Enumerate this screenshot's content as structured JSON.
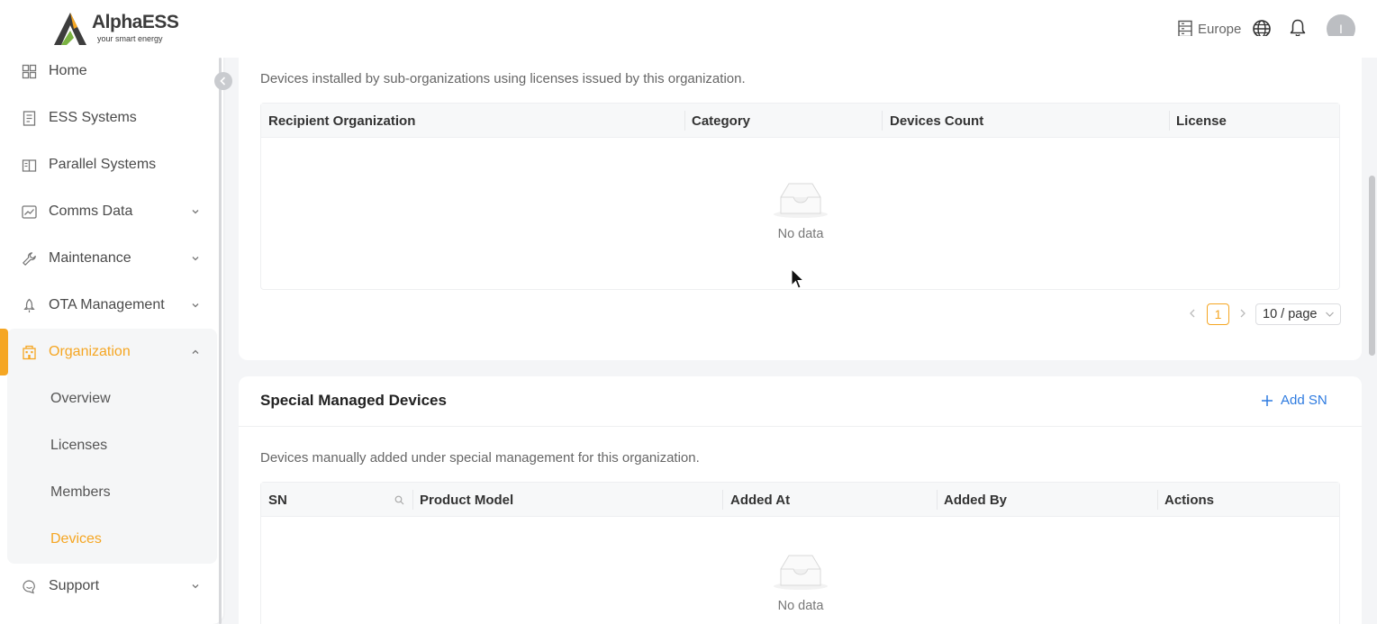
{
  "brand": {
    "name": "AlphaESS",
    "tagline": "your smart energy",
    "accent": "#f5a623"
  },
  "sidebar": {
    "items": [
      {
        "label": "Home",
        "icon": "home-grid-icon"
      },
      {
        "label": "ESS Systems",
        "icon": "ess-doc-icon"
      },
      {
        "label": "Parallel Systems",
        "icon": "parallel-book-icon"
      },
      {
        "label": "Comms Data",
        "icon": "chart-line-icon",
        "expandable": true
      },
      {
        "label": "Maintenance",
        "icon": "wrench-icon",
        "expandable": true
      },
      {
        "label": "OTA Management",
        "icon": "rocket-icon",
        "expandable": true
      },
      {
        "label": "Organization",
        "icon": "building-icon",
        "expandable": true,
        "expanded": true
      },
      {
        "label": "Support",
        "icon": "support-chat-icon",
        "expandable": true
      }
    ],
    "org_children": [
      {
        "label": "Overview"
      },
      {
        "label": "Licenses"
      },
      {
        "label": "Members"
      },
      {
        "label": "Devices",
        "active": true
      }
    ]
  },
  "topbar": {
    "region": "Europe",
    "avatar_initial": "I"
  },
  "licensed_section": {
    "description": "Devices installed by sub-organizations using licenses issued by this organization.",
    "columns": [
      "Recipient Organization",
      "Category",
      "Devices Count",
      "License"
    ],
    "rows": [],
    "empty_text": "No data",
    "pagination": {
      "current_page": "1",
      "page_size": "10 / page"
    }
  },
  "special_section": {
    "title": "Special Managed Devices",
    "add_label": "Add SN",
    "description": "Devices manually added under special management for this organization.",
    "columns": [
      "SN",
      "Product Model",
      "Added At",
      "Added By",
      "Actions"
    ],
    "rows": [],
    "empty_text": "No data"
  }
}
